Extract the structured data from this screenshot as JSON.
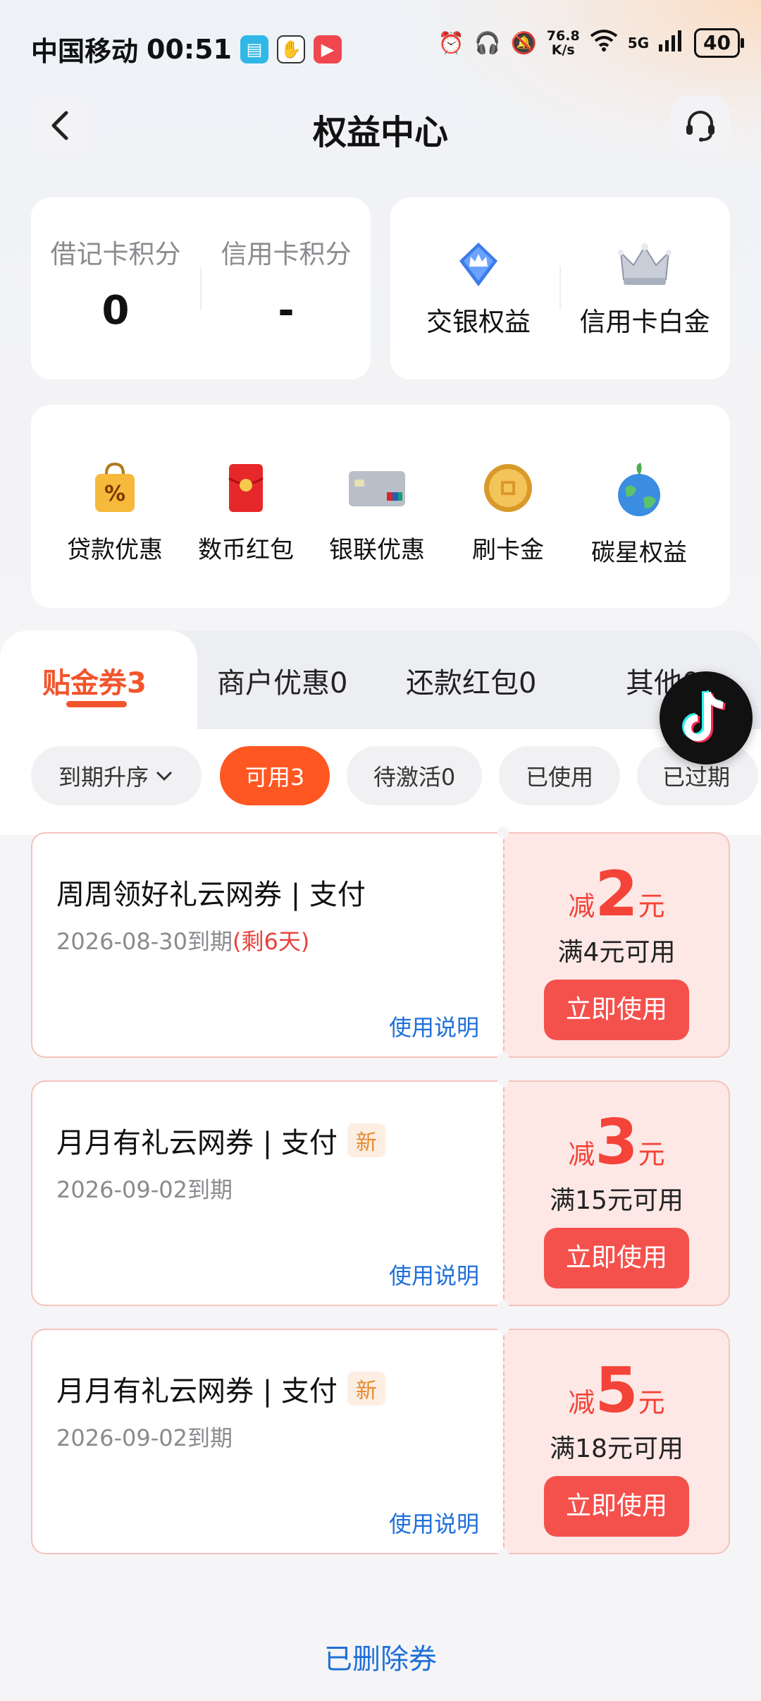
{
  "status_bar": {
    "carrier": "中国移动",
    "time": "00:51",
    "net_speed_value": "76.8",
    "net_speed_unit": "K/s",
    "network": "5G",
    "battery": "40"
  },
  "header": {
    "title": "权益中心"
  },
  "points": [
    {
      "label": "借记卡积分",
      "value": "0"
    },
    {
      "label": "信用卡积分",
      "value": "-"
    }
  ],
  "rights": [
    {
      "label": "交银权益",
      "icon": "shield-crown-icon"
    },
    {
      "label": "信用卡白金",
      "icon": "crown-icon"
    }
  ],
  "services": [
    {
      "label": "贷款优惠",
      "icon": "discount-bag-icon"
    },
    {
      "label": "数币红包",
      "icon": "red-envelope-icon"
    },
    {
      "label": "银联优惠",
      "icon": "unionpay-card-icon"
    },
    {
      "label": "刷卡金",
      "icon": "gold-coin-icon"
    },
    {
      "label": "碳星权益",
      "icon": "earth-plant-icon"
    }
  ],
  "tabs": [
    {
      "label": "贴金券3",
      "active": true
    },
    {
      "label": "商户优惠0"
    },
    {
      "label": "还款红包0"
    },
    {
      "label": "其他0"
    }
  ],
  "filters": {
    "sort": "到期升序",
    "chips": [
      "可用3",
      "待激活0",
      "已使用",
      "已过期"
    ]
  },
  "coupon_labels": {
    "reduce": "减",
    "unit": "元",
    "use_button": "立即使用",
    "rules_link": "使用说明",
    "new_badge": "新"
  },
  "coupons": [
    {
      "title": "周周领好礼云网券 | 支付",
      "date": "2026-08-30到期",
      "remaining": "(剩6天)",
      "amount": "2",
      "condition": "满4元可用",
      "is_new": false
    },
    {
      "title": "月月有礼云网券 | 支付",
      "date": "2026-09-02到期",
      "remaining": "",
      "amount": "3",
      "condition": "满15元可用",
      "is_new": true
    },
    {
      "title": "月月有礼云网券 | 支付",
      "date": "2026-09-02到期",
      "remaining": "",
      "amount": "5",
      "condition": "满18元可用",
      "is_new": true
    }
  ],
  "footer": {
    "deleted_link": "已删除券"
  },
  "colors": {
    "accent": "#f2552c",
    "coupon_red": "#f44338",
    "link_blue": "#1f6fd8"
  }
}
